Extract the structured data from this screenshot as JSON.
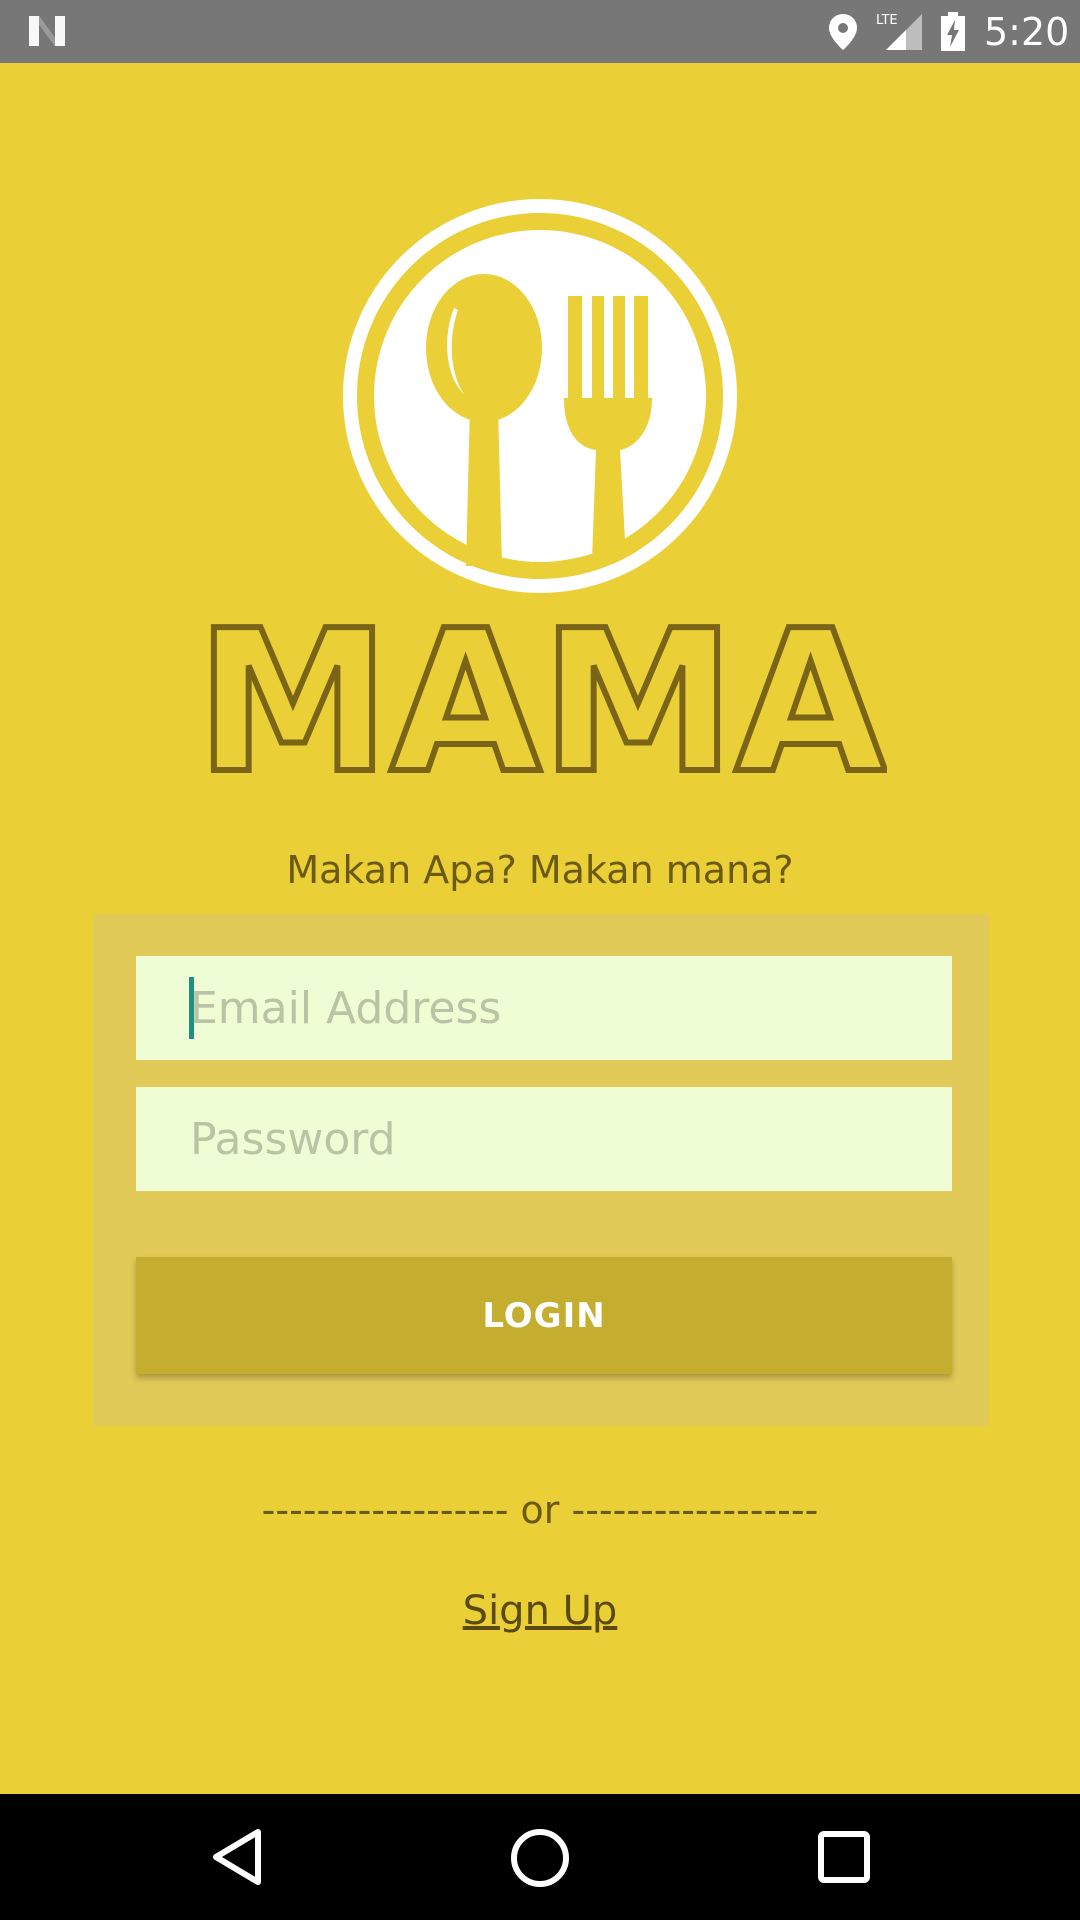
{
  "status_bar": {
    "time": "5:20",
    "network_label": "LTE",
    "icons": [
      "n-logo-icon",
      "location-icon",
      "signal-icon",
      "battery-charging-icon"
    ]
  },
  "brand": {
    "name": "MAMA",
    "tagline": "Makan Apa? Makan mana?",
    "logo_icon": "spoon-fork-plate-icon",
    "colors": {
      "background": "#EACF36",
      "wordmark": "#7A6418",
      "card": "#E2CA58",
      "input_bg": "#EEFDD4",
      "button": "#C5AD30"
    }
  },
  "login_form": {
    "email_placeholder": "Email Address",
    "email_value": "",
    "password_placeholder": "Password",
    "password_value": "",
    "login_label": "LOGIN"
  },
  "divider_text": "------------------ or ------------------",
  "signup_label": "Sign Up",
  "nav_bar": {
    "icons": [
      "back-icon",
      "home-icon",
      "recents-icon"
    ]
  }
}
